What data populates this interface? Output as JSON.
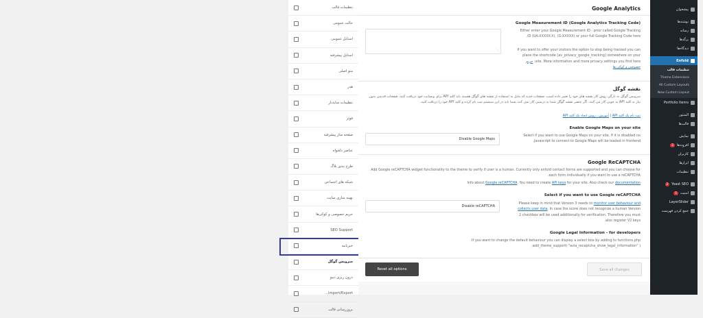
{
  "admin_menu": {
    "items": [
      {
        "label": "پیشخوان",
        "icon": "dashboard-icon"
      },
      {
        "label": "نوشته‌ها",
        "icon": "pin-icon"
      },
      {
        "label": "رسانه",
        "icon": "media-icon"
      },
      {
        "label": "برگه‌ها",
        "icon": "pages-icon"
      },
      {
        "label": "دیدگاه‌ها",
        "icon": "comments-icon"
      },
      {
        "label": "Enfold",
        "icon": "home-icon",
        "active": true
      }
    ],
    "submenu": [
      "تنظیمات قالب",
      "Theme Extensions",
      "All Custom Layouts",
      "New Custom Layout"
    ],
    "items_after": [
      {
        "label": "Portfolio Items",
        "icon": "portfolio-icon"
      },
      {
        "label": "المنتور",
        "icon": "elementor-icon"
      },
      {
        "label": "قالب‌ها",
        "icon": "templates-icon"
      },
      {
        "label": "نمایش",
        "icon": "appearance-icon"
      },
      {
        "label": "افزونه‌ها",
        "icon": "plugins-icon",
        "badge": "3"
      },
      {
        "label": "کاربران",
        "icon": "users-icon"
      },
      {
        "label": "ابزارها",
        "icon": "tools-icon"
      },
      {
        "label": "تنظیمات",
        "icon": "settings-icon"
      }
    ],
    "items_bottom": [
      {
        "label": "Yoast SEO",
        "icon": "yoast-icon",
        "badge": "2"
      },
      {
        "label": "امنیت",
        "icon": "security-icon",
        "badge": "1"
      },
      {
        "label": "LayerSlider",
        "icon": "layerslider-icon"
      },
      {
        "label": "جمع کردن فهرست",
        "icon": "collapse-icon"
      }
    ]
  },
  "content": {
    "title": "Google Analytics",
    "measurement": {
      "label": "Google Measurement ID (Google Analytics Tracking Code)",
      "desc1": "Either enter your Google Measurement ID - prior called Google Tracking ID (UA-XXXXX-X), (G-XXXXX) or your full Google Tracking Code here.",
      "desc2": "If you want to offer your visitors the option to stop being tracked you can place the shortcode [av_privacy_google_tracking] somewhere on your site. More information and more privacy settings you find here:",
      "link": "حریم خصوصی و کوکی ها"
    },
    "maps": {
      "title": "نقشه گوگل",
      "desc": "سرویس گوگل به تازگی روش کار نقشه های خود را تغییر داده است. صفحات جدید که مایل به استفاده از نقشه های گوگل هستند باید کلید API برای وبسایت خود دریافت کنند. صفحات قدیمی بدون نیاز به کلید API به خوبی کار می کنند. اگر عنصر نقشه گوگل شما به درستی کار نمی کند، شما باید در این سیستم ثبت نام کرده و کلید API خود را دریافت کنید.",
      "link_a": "ثبت نام یک کلید API",
      "link_sep": "|",
      "link_b": "آموزش ـ روش ایجاد یک کلید API",
      "enable_label": "Enable Google Maps on your site",
      "enable_desc": "Select if you want to use Google Maps on your site. If it is disabled no Javascript to connect to Google Maps will be loaded in frontend.",
      "select_value": "Disable Google Maps"
    },
    "recaptcha": {
      "title": "Google ReCAPTCHA",
      "intro1": "Add Google reCAPTCHA widget functionality to the theme to verify if user is a human. Currently only enfold contact forms are supported and you can choose for each form individually if you want to use a reCAPTCHA.",
      "intro2_pre": "Info about",
      "intro2_link1": "Google reCAPTCHA",
      "intro2_mid": ". You need to create",
      "intro2_link2": "API keys",
      "intro2_post": "for your site. Also check our",
      "intro2_link3": "documentation",
      "select_label": "Select if you want to use Google reCAPTCHA",
      "select_desc_pre": "Please keep in mind that Version 3 needs to",
      "select_desc_link": "monitor user behaviour and collects user data",
      "select_desc_post": ". In case the score does not recognize a human Version 2 checkbox will be used additionally for verification. Therefore you must also register V2 keys.",
      "select_value": "Disable reCAPTCHA",
      "legal_label": "Google Legal Information - for developers",
      "legal_desc1": "If you want to change the default behaviour you can display a select box by adding to functions.php:",
      "legal_desc2": "add_theme_support( \"avia_recaptcha_show_legal_information\" );"
    },
    "reset_label": "Reset all options",
    "save_label": "Save all changes"
  },
  "tabs": [
    {
      "label": "تنظیمات قالب",
      "icon": "tools-icon"
    },
    {
      "label": "حالت عمومی",
      "icon": "layout-icon"
    },
    {
      "label": "استایل عمومی",
      "icon": "palette-icon"
    },
    {
      "label": "استایل پیشرفته",
      "icon": "wand-icon"
    },
    {
      "label": "منو اصلی",
      "icon": "menu-icon"
    },
    {
      "label": "هدر",
      "icon": "header-icon"
    },
    {
      "label": "تنظیمات سایدبار",
      "icon": "sidebar-icon"
    },
    {
      "label": "فوتر",
      "icon": "footer-icon"
    },
    {
      "label": "صفحه ساز پیشرفته",
      "icon": "builder-icon"
    },
    {
      "label": "عناصر دلخواه",
      "icon": "elements-icon"
    },
    {
      "label": "طرح بندی بلاگ",
      "icon": "blog-icon"
    },
    {
      "label": "شبکه های اجتماعی",
      "icon": "social-icon"
    },
    {
      "label": "بهینه سازی سایت",
      "icon": "speed-icon"
    },
    {
      "label": "حریم خصوصی و کوکی‌ها",
      "icon": "gear-icon"
    },
    {
      "label": "SEO Support",
      "icon": "search-icon"
    },
    {
      "label": "خبرنامه",
      "icon": "newsletter-icon"
    },
    {
      "label": "سرویس گوگل",
      "icon": "map-icon",
      "active": true
    },
    {
      "label": "درون ریزی دمو",
      "icon": "import-icon"
    },
    {
      "label": "Import/Export...",
      "icon": "export-icon"
    },
    {
      "label": "بروزرسانی قالب",
      "icon": "update-icon"
    }
  ]
}
